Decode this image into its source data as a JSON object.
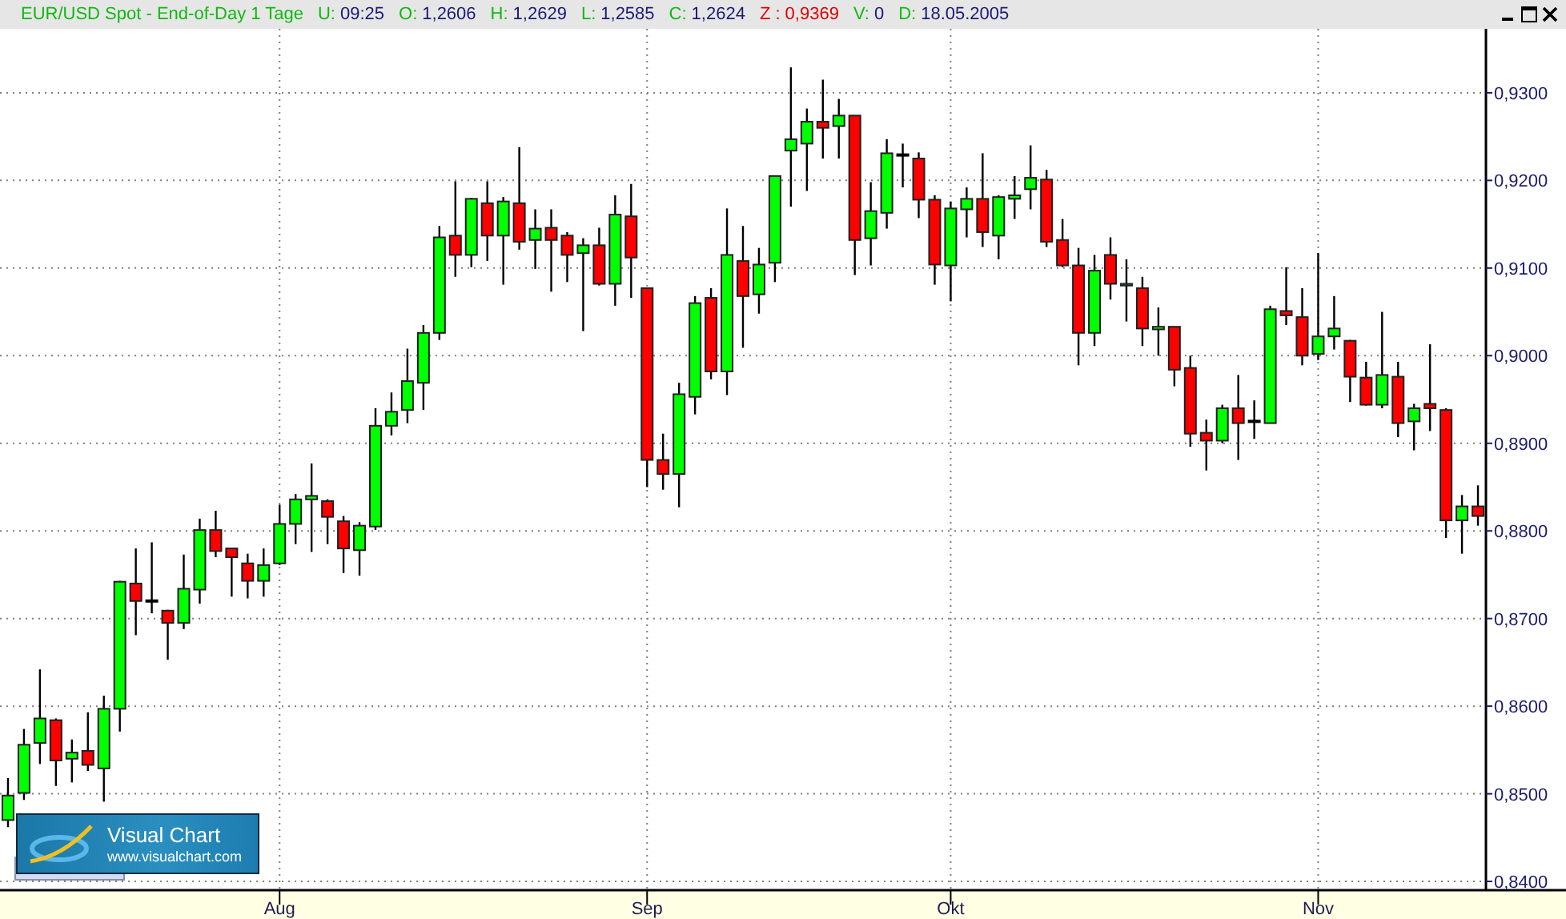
{
  "header": {
    "title": "EUR/USD Spot - End-of-Day 1 Tage",
    "fields": [
      {
        "label": "U:",
        "value": "09:25",
        "kind": "normal"
      },
      {
        "label": "O:",
        "value": "1,2606",
        "kind": "normal"
      },
      {
        "label": "H:",
        "value": "1,2629",
        "kind": "normal"
      },
      {
        "label": "L:",
        "value": "1,2585",
        "kind": "normal"
      },
      {
        "label": "C:",
        "value": "1,2624",
        "kind": "normal"
      },
      {
        "label": "Z :",
        "value": "0,9369",
        "kind": "alert"
      },
      {
        "label": "V:",
        "value": "0",
        "kind": "normal"
      },
      {
        "label": "D:",
        "value": "18.05.2005",
        "kind": "normal"
      }
    ]
  },
  "chart": {
    "chart_data": {
      "type": "candlestick",
      "grid": true,
      "ylim": [
        0.839,
        0.9373
      ],
      "categories": [
        null,
        null,
        null,
        null,
        null,
        null,
        null,
        null,
        null,
        null,
        null,
        null,
        null,
        null,
        null,
        null,
        null,
        "Aug",
        null,
        null,
        null,
        null,
        null,
        null,
        null,
        null,
        null,
        null,
        null,
        null,
        null,
        null,
        null,
        null,
        null,
        null,
        null,
        null,
        null,
        null,
        "Sep",
        null,
        null,
        null,
        null,
        null,
        null,
        null,
        null,
        null,
        null,
        null,
        null,
        null,
        null,
        null,
        null,
        null,
        null,
        "Okt",
        null,
        null,
        null,
        null,
        null,
        null,
        null,
        null,
        null,
        null,
        null,
        null,
        null,
        null,
        null,
        null,
        null,
        null,
        null,
        null,
        null,
        null,
        "Nov",
        null,
        null,
        null,
        null,
        null,
        null,
        null,
        null,
        null,
        null
      ],
      "yticks": [
        {
          "value": 0.93,
          "label": "0,9300"
        },
        {
          "value": 0.92,
          "label": "0,9200"
        },
        {
          "value": 0.91,
          "label": "0,9100"
        },
        {
          "value": 0.9,
          "label": "0,9000"
        },
        {
          "value": 0.89,
          "label": "0,8900"
        },
        {
          "value": 0.88,
          "label": "0,8800"
        },
        {
          "value": 0.87,
          "label": "0,8700"
        },
        {
          "value": 0.86,
          "label": "0,8600"
        },
        {
          "value": 0.85,
          "label": "0,8500"
        },
        {
          "value": 0.84,
          "label": "0,8400"
        }
      ],
      "ohlc": [
        [
          0.847,
          0.8518,
          0.8462,
          0.8498
        ],
        [
          0.8501,
          0.8574,
          0.8493,
          0.8556
        ],
        [
          0.8558,
          0.8642,
          0.8534,
          0.8586
        ],
        [
          0.8584,
          0.8586,
          0.8509,
          0.8538
        ],
        [
          0.854,
          0.8562,
          0.8513,
          0.8547
        ],
        [
          0.8549,
          0.8593,
          0.8526,
          0.8533
        ],
        [
          0.8529,
          0.8612,
          0.8491,
          0.8597
        ],
        [
          0.8597,
          0.8743,
          0.8571,
          0.8742
        ],
        [
          0.874,
          0.878,
          0.8681,
          0.872
        ],
        [
          0.872,
          0.8787,
          0.8706,
          0.872
        ],
        [
          0.8709,
          0.871,
          0.8653,
          0.8695
        ],
        [
          0.8695,
          0.8773,
          0.8688,
          0.8734
        ],
        [
          0.8733,
          0.8814,
          0.8717,
          0.8801
        ],
        [
          0.8801,
          0.8823,
          0.877,
          0.8777
        ],
        [
          0.878,
          0.878,
          0.8725,
          0.877
        ],
        [
          0.8763,
          0.8774,
          0.8723,
          0.8743
        ],
        [
          0.8743,
          0.878,
          0.8725,
          0.8761
        ],
        [
          0.8763,
          0.883,
          0.8761,
          0.8808
        ],
        [
          0.8808,
          0.8842,
          0.8785,
          0.8836
        ],
        [
          0.8836,
          0.8877,
          0.8776,
          0.884
        ],
        [
          0.8834,
          0.8836,
          0.8785,
          0.8816
        ],
        [
          0.8811,
          0.8817,
          0.8752,
          0.878
        ],
        [
          0.8778,
          0.881,
          0.8749,
          0.8806
        ],
        [
          0.8805,
          0.894,
          0.8801,
          0.892
        ],
        [
          0.892,
          0.8958,
          0.8909,
          0.8936
        ],
        [
          0.8938,
          0.9008,
          0.8923,
          0.8971
        ],
        [
          0.8969,
          0.9035,
          0.8938,
          0.9026
        ],
        [
          0.9026,
          0.9148,
          0.9018,
          0.9135
        ],
        [
          0.9137,
          0.9199,
          0.909,
          0.9115
        ],
        [
          0.9115,
          0.918,
          0.9101,
          0.9179
        ],
        [
          0.9174,
          0.9199,
          0.9108,
          0.9137
        ],
        [
          0.9137,
          0.9181,
          0.9081,
          0.9176
        ],
        [
          0.9174,
          0.9238,
          0.9121,
          0.913
        ],
        [
          0.9132,
          0.9167,
          0.9099,
          0.9145
        ],
        [
          0.9146,
          0.9167,
          0.9073,
          0.9132
        ],
        [
          0.9137,
          0.9141,
          0.9084,
          0.9115
        ],
        [
          0.9117,
          0.9134,
          0.9028,
          0.9126
        ],
        [
          0.9126,
          0.9146,
          0.908,
          0.9082
        ],
        [
          0.9082,
          0.9183,
          0.9057,
          0.9161
        ],
        [
          0.9159,
          0.9196,
          0.9066,
          0.9112
        ],
        [
          0.9077,
          0.9077,
          0.885,
          0.8881
        ],
        [
          0.8881,
          0.8911,
          0.8847,
          0.8865
        ],
        [
          0.8865,
          0.8969,
          0.8827,
          0.8956
        ],
        [
          0.8953,
          0.9068,
          0.8933,
          0.906
        ],
        [
          0.9066,
          0.9077,
          0.8973,
          0.8982
        ],
        [
          0.8982,
          0.9168,
          0.8955,
          0.9115
        ],
        [
          0.9108,
          0.9148,
          0.9009,
          0.9068
        ],
        [
          0.907,
          0.9123,
          0.9048,
          0.9104
        ],
        [
          0.9106,
          0.9205,
          0.9084,
          0.9205
        ],
        [
          0.9234,
          0.9329,
          0.917,
          0.9247
        ],
        [
          0.9242,
          0.9282,
          0.9188,
          0.9267
        ],
        [
          0.9267,
          0.9315,
          0.9225,
          0.926
        ],
        [
          0.9262,
          0.9293,
          0.9225,
          0.9274
        ],
        [
          0.9274,
          0.9274,
          0.9092,
          0.9132
        ],
        [
          0.9134,
          0.9198,
          0.9103,
          0.9165
        ],
        [
          0.9163,
          0.9247,
          0.9145,
          0.9231
        ],
        [
          0.9229,
          0.9242,
          0.9192,
          0.9229
        ],
        [
          0.9225,
          0.9232,
          0.9157,
          0.9178
        ],
        [
          0.9178,
          0.9183,
          0.9081,
          0.9104
        ],
        [
          0.9103,
          0.9176,
          0.9062,
          0.9168
        ],
        [
          0.9167,
          0.9192,
          0.9135,
          0.9179
        ],
        [
          0.9179,
          0.9231,
          0.9124,
          0.9141
        ],
        [
          0.9137,
          0.9183,
          0.911,
          0.9181
        ],
        [
          0.9179,
          0.9205,
          0.9156,
          0.9183
        ],
        [
          0.919,
          0.924,
          0.9167,
          0.9203
        ],
        [
          0.9201,
          0.9212,
          0.9124,
          0.913
        ],
        [
          0.9132,
          0.9156,
          0.9101,
          0.9103
        ],
        [
          0.9103,
          0.9123,
          0.8989,
          0.9026
        ],
        [
          0.9026,
          0.9115,
          0.9011,
          0.9097
        ],
        [
          0.9115,
          0.9135,
          0.9064,
          0.9082
        ],
        [
          0.908,
          0.911,
          0.9039,
          0.9082
        ],
        [
          0.9077,
          0.909,
          0.9011,
          0.9031
        ],
        [
          0.903,
          0.9055,
          0.9,
          0.9033
        ],
        [
          0.9033,
          0.9033,
          0.8965,
          0.8984
        ],
        [
          0.8986,
          0.9,
          0.8896,
          0.8911
        ],
        [
          0.8912,
          0.8927,
          0.8869,
          0.8903
        ],
        [
          0.8903,
          0.8944,
          0.89,
          0.894
        ],
        [
          0.894,
          0.8978,
          0.8881,
          0.8923
        ],
        [
          0.8925,
          0.8949,
          0.8905,
          0.8925
        ],
        [
          0.8923,
          0.9057,
          0.8923,
          0.9053
        ],
        [
          0.9051,
          0.9101,
          0.9035,
          0.9046
        ],
        [
          0.9044,
          0.9077,
          0.8989,
          0.9
        ],
        [
          0.9002,
          0.9117,
          0.8995,
          0.9022
        ],
        [
          0.9022,
          0.9068,
          0.9007,
          0.9031
        ],
        [
          0.9017,
          0.9018,
          0.8947,
          0.8976
        ],
        [
          0.8975,
          0.8993,
          0.8943,
          0.8944
        ],
        [
          0.8944,
          0.905,
          0.894,
          0.8978
        ],
        [
          0.8976,
          0.8993,
          0.8907,
          0.8923
        ],
        [
          0.8925,
          0.8945,
          0.8892,
          0.894
        ],
        [
          0.8945,
          0.9013,
          0.8914,
          0.894
        ],
        [
          0.8938,
          0.894,
          0.8792,
          0.8812
        ],
        [
          0.8812,
          0.8841,
          0.8774,
          0.8828
        ],
        [
          0.8828,
          0.8852,
          0.8806,
          0.8817
        ]
      ]
    }
  },
  "logo": {
    "title": "Visual Chart",
    "url": "www.visualchart.com"
  }
}
